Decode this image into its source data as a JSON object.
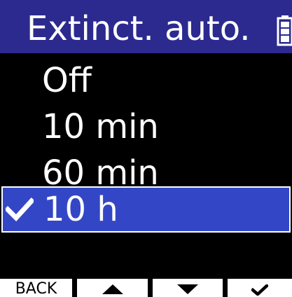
{
  "header": {
    "title": "Extinct. auto.",
    "status_icon": "battery-icon"
  },
  "menu": {
    "items": [
      {
        "label": "Off",
        "selected": false
      },
      {
        "label": "10 min",
        "selected": false
      },
      {
        "label": "60 min",
        "selected": false
      },
      {
        "label": "10 h",
        "selected": true
      }
    ],
    "selected_icon": "checkmark-icon"
  },
  "function_bar": {
    "back_label": "BACK",
    "up_icon": "arrow-up-icon",
    "down_icon": "arrow-down-icon",
    "confirm_icon": "checkmark-icon"
  },
  "colors": {
    "title_bar": "#2c2a8e",
    "selection": "#3347c6",
    "background": "#000000",
    "text": "#ffffff"
  }
}
